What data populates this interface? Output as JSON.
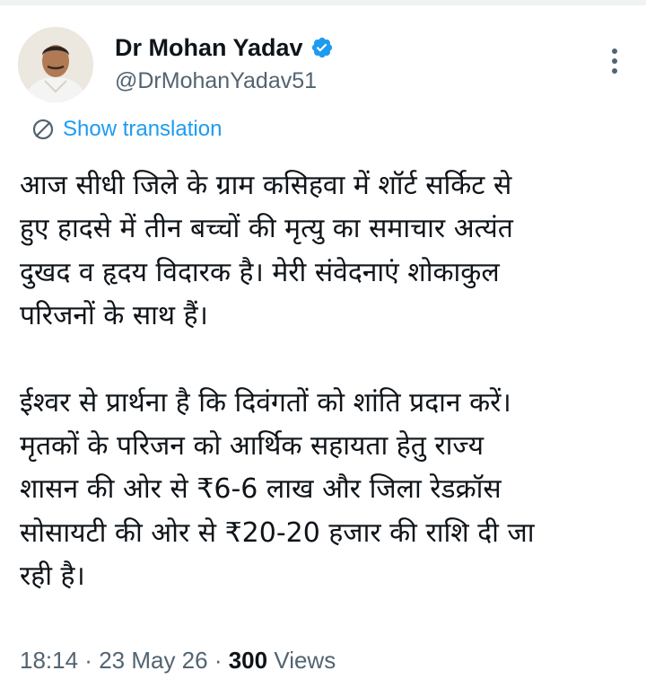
{
  "tweet": {
    "author": {
      "display_name": "Dr Mohan Yadav",
      "handle": "@DrMohanYadav51",
      "verified": true
    },
    "translate_label": "Show translation",
    "paragraphs": [
      [
        "आज सीधी जिले के ग्राम कसिहवा में शॉर्ट सर्किट से",
        "हुए हादसे में तीन बच्चों की मृत्यु का समाचार अत्यंत",
        "दुखद व हृदय विदारक है। मेरी संवेदनाएं शोकाकुल",
        "परिजनों के साथ हैं।"
      ],
      [
        "ईश्वर से प्रार्थना है कि दिवंगतों को शांति प्रदान करें।",
        "मृतकों के परिजन को आर्थिक सहायता हेतु राज्य",
        "शासन की ओर से ₹6-6 लाख और जिला रेडक्रॉस",
        "सोसायटी की ओर से ₹20-20 हजार की राशि दी जा",
        "रही है।"
      ]
    ],
    "meta": {
      "time": "18:14",
      "date": "23 May 26",
      "separator": " · ",
      "views_count": "300",
      "views_label": "Views"
    }
  },
  "colors": {
    "link_blue": "#1d9bf0",
    "secondary_text": "#536471",
    "primary_text": "#0f1419",
    "verified_badge": "#1d9bf0"
  },
  "icons": {
    "verified": "verified-badge-icon",
    "more": "more-vertical-icon",
    "translate": "translate-icon"
  }
}
